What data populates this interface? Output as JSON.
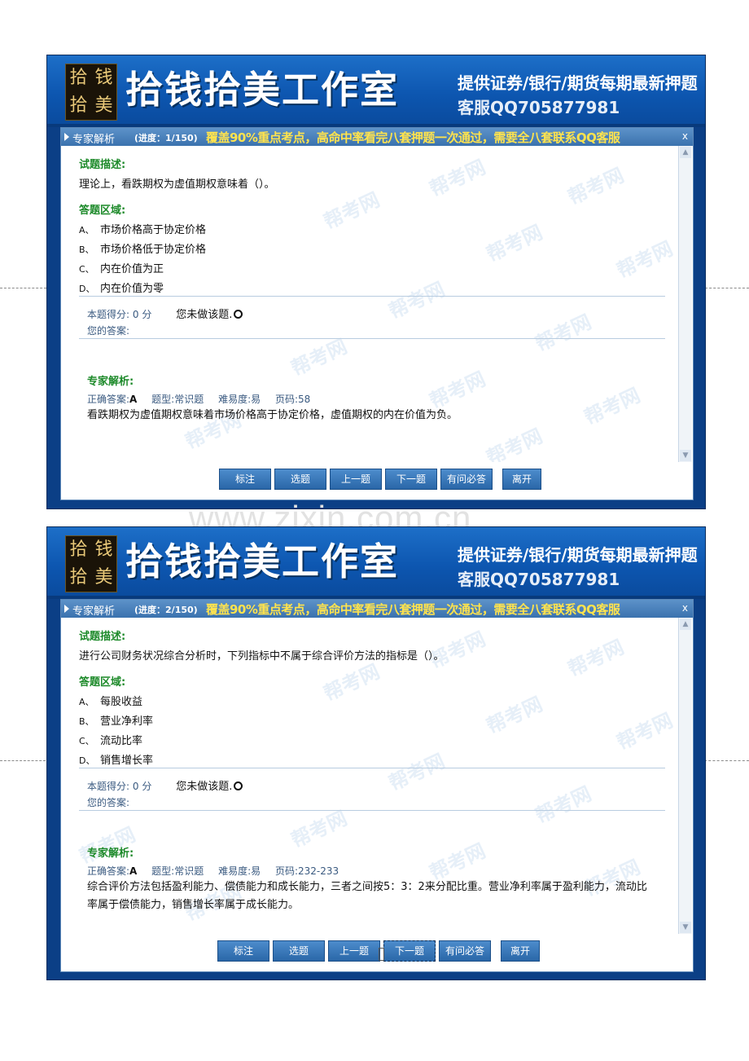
{
  "banner": {
    "logo_chars": [
      "拾",
      "钱",
      "拾",
      "美"
    ],
    "studio_name": "拾钱拾美工作室",
    "tagline": "提供证券/银行/期货每期最新押题",
    "service_qq": "客服QQ705877981"
  },
  "site_watermark": "www.zixin.com.cn",
  "panel_watermark": "帮考网",
  "labels": {
    "panel_title": "专家解析",
    "promo": "覆盖90%重点考点，高命中率看完八套押题一次通过，需要全八套联系QQ客服",
    "close": "x",
    "description": "试题描述:",
    "answer_area": "答题区域:",
    "score_label": "本题得分:",
    "score_value": "0",
    "score_unit": "分",
    "not_done": "您未做该题.",
    "your_answer": "您的答案:",
    "analysis": "专家解析:",
    "correct_label": "正确答案:",
    "type_label": "题型:",
    "difficulty_label": "难易度:",
    "page_label": "页码:"
  },
  "buttons": [
    "标注",
    "选题",
    "上一题",
    "下一题",
    "有问必答",
    "离开"
  ],
  "questions": [
    {
      "progress": "(进度：1/150)",
      "description": "理论上，看跌期权为虚值期权意味着（）。",
      "options": [
        {
          "key": "A、",
          "text": "市场价格高于协定价格"
        },
        {
          "key": "B、",
          "text": "市场价格低于协定价格"
        },
        {
          "key": "C、",
          "text": "内在价值为正"
        },
        {
          "key": "D、",
          "text": "内在价值为零"
        }
      ],
      "correct_answer": "A",
      "type": "常识题",
      "difficulty": "易",
      "page": "58",
      "explanation": "看跌期权为虚值期权意味着市场价格高于协定价格，虚值期权的内在价值为负。"
    },
    {
      "progress": "(进度：2/150)",
      "description": "进行公司财务状况综合分析时，下列指标中不属于综合评价方法的指标是（）。",
      "options": [
        {
          "key": "A、",
          "text": "每股收益"
        },
        {
          "key": "B、",
          "text": "营业净利率"
        },
        {
          "key": "C、",
          "text": "流动比率"
        },
        {
          "key": "D、",
          "text": "销售增长率"
        }
      ],
      "correct_answer": "A",
      "type": "常识题",
      "difficulty": "易",
      "page": "232-233",
      "explanation": "综合评价方法包括盈利能力、偿债能力和成长能力，三者之间按5：3：2来分配比重。营业净利率属于盈利能力，流动比率属于偿债能力，销售增长率属于成长能力。"
    }
  ]
}
